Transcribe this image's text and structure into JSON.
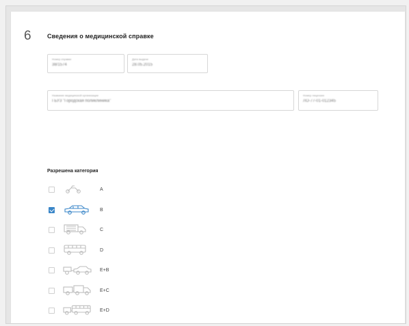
{
  "section": {
    "number": "6",
    "title": "Сведения о медицинской справке"
  },
  "fields": {
    "cert_number": {
      "label": "Номер справки",
      "value": "38/1574"
    },
    "issue_date": {
      "label": "Дата выдачи",
      "value": "28.05.2015"
    },
    "org": {
      "label": "Название медицинской организации",
      "value": "ГБУЗ \"Городская поликлиника\""
    },
    "license": {
      "label": "Номер лицензии",
      "value": "ЛО-77-01-012345"
    }
  },
  "categories": {
    "title": "Разрешена категория",
    "items": [
      {
        "letter": "A",
        "vehicle": "motorcycle-icon",
        "checked": false
      },
      {
        "letter": "B",
        "vehicle": "car-icon",
        "checked": true
      },
      {
        "letter": "C",
        "vehicle": "truck-icon",
        "checked": false
      },
      {
        "letter": "D",
        "vehicle": "bus-icon",
        "checked": false
      },
      {
        "letter": "E+B",
        "vehicle": "car-trailer-icon",
        "checked": false
      },
      {
        "letter": "E+C",
        "vehicle": "truck-trailer-icon",
        "checked": false
      },
      {
        "letter": "E+D",
        "vehicle": "bus-trailer-icon",
        "checked": false
      }
    ]
  },
  "colors": {
    "accent": "#3a86c8",
    "icon_inactive": "#bdbdbd",
    "border": "#d6d6d6"
  }
}
